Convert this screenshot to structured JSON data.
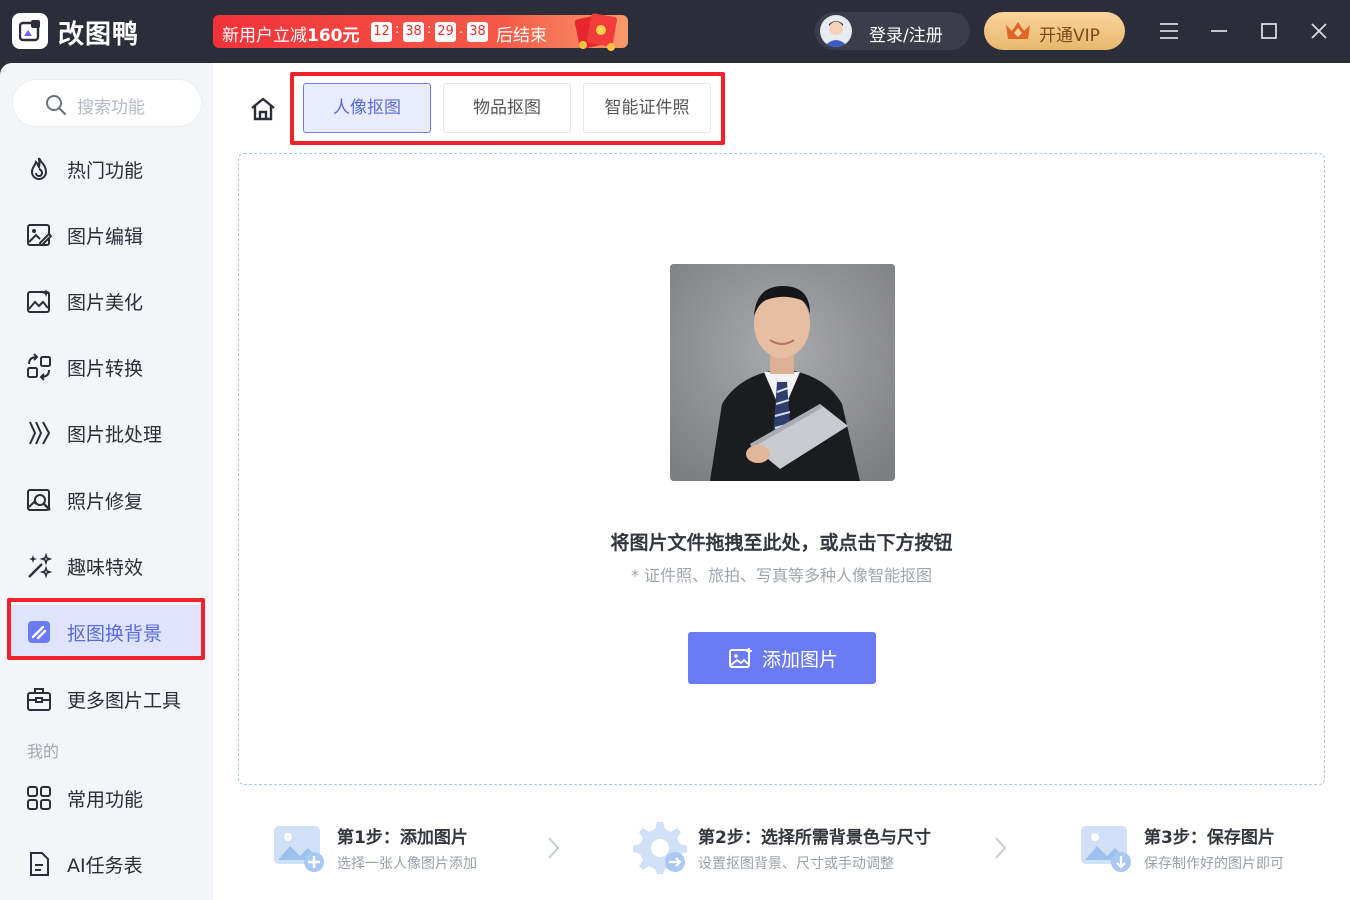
{
  "app": {
    "name": "改图鸭"
  },
  "promo": {
    "prefix": "新用户立减",
    "amount": "160元",
    "countdown": [
      "12",
      "38",
      "29",
      "38"
    ],
    "suffix": "后结束"
  },
  "header": {
    "login_label": "登录/注册",
    "vip_label": "开通VIP"
  },
  "sidebar": {
    "search_placeholder": "搜索功能",
    "items": [
      {
        "label": "热门功能",
        "icon": "flame-icon"
      },
      {
        "label": "图片编辑",
        "icon": "image-edit-icon"
      },
      {
        "label": "图片美化",
        "icon": "image-sparkle-icon"
      },
      {
        "label": "图片转换",
        "icon": "convert-icon"
      },
      {
        "label": "图片批处理",
        "icon": "batch-icon"
      },
      {
        "label": "照片修复",
        "icon": "photo-repair-icon"
      },
      {
        "label": "趣味特效",
        "icon": "magic-wand-icon"
      },
      {
        "label": "抠图换背景",
        "icon": "cutout-icon",
        "active": true
      },
      {
        "label": "更多图片工具",
        "icon": "toolbox-icon"
      }
    ],
    "section_mine": "我的",
    "mine_items": [
      {
        "label": "常用功能",
        "icon": "grid-icon"
      },
      {
        "label": "AI任务表",
        "icon": "document-icon"
      }
    ]
  },
  "tabs": [
    {
      "label": "人像抠图",
      "active": true
    },
    {
      "label": "物品抠图",
      "active": false
    },
    {
      "label": "智能证件照",
      "active": false
    }
  ],
  "dropzone": {
    "title": "将图片文件拖拽至此处，或点击下方按钮",
    "subtitle": "* 证件照、旅拍、写真等多种人像智能抠图",
    "button_label": "添加图片"
  },
  "steps": [
    {
      "title": "第1步：添加图片",
      "desc": "选择一张人像图片添加"
    },
    {
      "title": "第2步：选择所需背景色与尺寸",
      "desc": "设置抠图背景、尺寸或手动调整"
    },
    {
      "title": "第3步：保存图片",
      "desc": "保存制作好的图片即可"
    }
  ],
  "colors": {
    "accent": "#6b7bf6",
    "highlight_outline": "#f2222a",
    "titlebar": "#2b2e38"
  }
}
